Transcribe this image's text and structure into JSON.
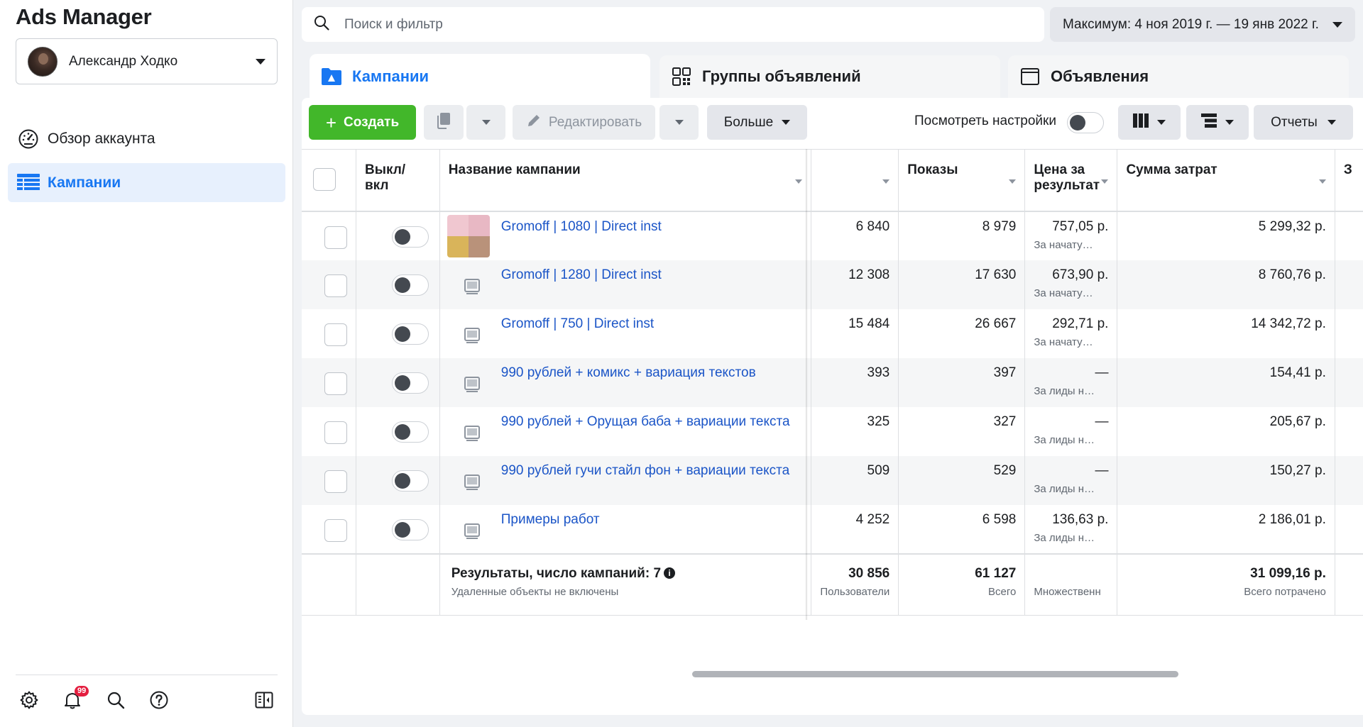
{
  "app": {
    "title": "Ads Manager"
  },
  "account": {
    "name": "Александр Ходко"
  },
  "nav": {
    "overview": "Обзор аккаунта",
    "campaigns": "Кампании"
  },
  "notifications": {
    "count": "99"
  },
  "search": {
    "placeholder": "Поиск и фильтр"
  },
  "date_range": {
    "label": "Максимум: 4 ноя 2019 г. — 19 янв 2022 г."
  },
  "tabs": [
    {
      "label": "Кампании",
      "active": true
    },
    {
      "label": "Группы объявлений",
      "active": false
    },
    {
      "label": "Объявления",
      "active": false
    }
  ],
  "toolbar": {
    "create": "Создать",
    "edit": "Редактировать",
    "more": "Больше",
    "view_settings": "Посмотреть настройки",
    "reports": "Отчеты"
  },
  "table": {
    "headers": {
      "toggle": "Выкл/ вкл",
      "name": "Название кампании",
      "reach": "",
      "impressions": "Показы",
      "cost_per_result": "Цена за результат",
      "amount_spent": "Сумма затрат",
      "next": "З"
    },
    "rows": [
      {
        "name": "Gromoff | 1080 | Direct inst",
        "reach": "6 840",
        "impressions": "8 979",
        "cpr": "757,05 р.",
        "cpr_sub": "За начату…",
        "spent": "5 299,32 р.",
        "has_image": true
      },
      {
        "name": "Gromoff | 1280 | Direct inst",
        "reach": "12 308",
        "impressions": "17 630",
        "cpr": "673,90 р.",
        "cpr_sub": "За начату…",
        "spent": "8 760,76 р.",
        "has_image": false
      },
      {
        "name": "Gromoff | 750 | Direct inst",
        "reach": "15 484",
        "impressions": "26 667",
        "cpr": "292,71 р.",
        "cpr_sub": "За начату…",
        "spent": "14 342,72 р.",
        "has_image": false
      },
      {
        "name": "990 рублей + комикс + вариация текстов",
        "reach": "393",
        "impressions": "397",
        "cpr": "—",
        "cpr_sub": "За лиды н…",
        "spent": "154,41 р.",
        "has_image": false
      },
      {
        "name": "990 рублей + Орущая баба + вариации текста",
        "reach": "325",
        "impressions": "327",
        "cpr": "—",
        "cpr_sub": "За лиды н…",
        "spent": "205,67 р.",
        "has_image": false
      },
      {
        "name": "990 рублей гучи стайл фон + вариации текста",
        "reach": "509",
        "impressions": "529",
        "cpr": "—",
        "cpr_sub": "За лиды н…",
        "spent": "150,27 р.",
        "has_image": false
      },
      {
        "name": "Примеры работ",
        "reach": "4 252",
        "impressions": "6 598",
        "cpr": "136,63 р.",
        "cpr_sub": "За лиды н…",
        "spent": "2 186,01 р.",
        "has_image": false
      }
    ],
    "summary": {
      "label": "Результаты, число кампаний: 7",
      "label_sub": "Удаленные объекты не включены",
      "reach": "30 856",
      "reach_sub": "Пользователи",
      "impressions": "61 127",
      "impressions_sub": "Всего",
      "cpr_sub": "Множественн",
      "spent": "31 099,16 р.",
      "spent_sub": "Всего потрачено"
    }
  },
  "colors": {
    "accent": "#1877f2",
    "create_button": "#42b72a",
    "link": "#1b55c7",
    "badge": "#e41e3f"
  },
  "icons": {
    "search": "search-icon",
    "settings": "gear-icon",
    "notifications": "bell-icon",
    "help": "help-icon",
    "panel": "panel-toggle-icon"
  }
}
